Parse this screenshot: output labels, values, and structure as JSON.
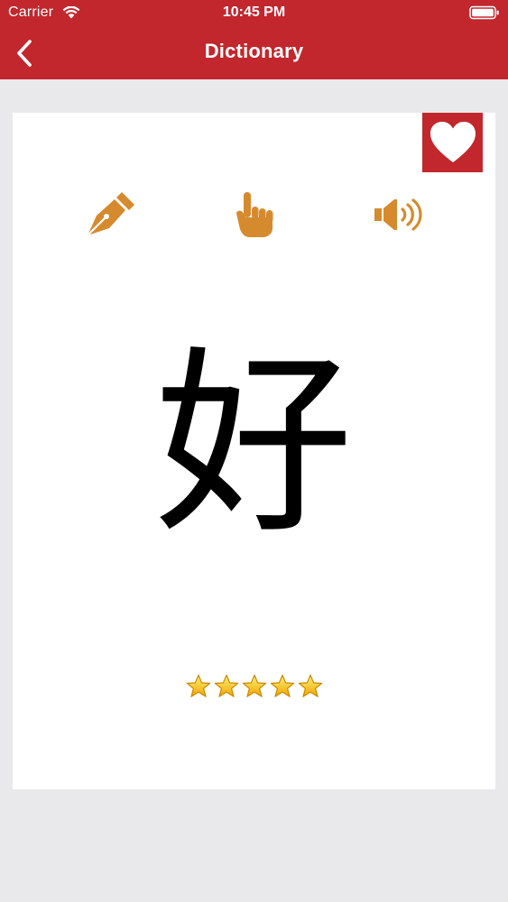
{
  "status_bar": {
    "carrier": "Carrier",
    "time": "10:45 PM"
  },
  "nav": {
    "title": "Dictionary",
    "back_icon": "chevron-left-icon"
  },
  "card": {
    "character": "好",
    "favorite_icon": "heart-icon",
    "tools": [
      {
        "name": "pen",
        "icon": "fountain-pen-icon"
      },
      {
        "name": "hand",
        "icon": "pointing-hand-icon"
      },
      {
        "name": "sound",
        "icon": "speaker-icon"
      }
    ],
    "rating": {
      "value": 5,
      "max": 5
    }
  },
  "colors": {
    "header": "#c1272d",
    "accent_icons": "#d68a2e",
    "background": "#e9e9eb",
    "card": "#ffffff"
  }
}
